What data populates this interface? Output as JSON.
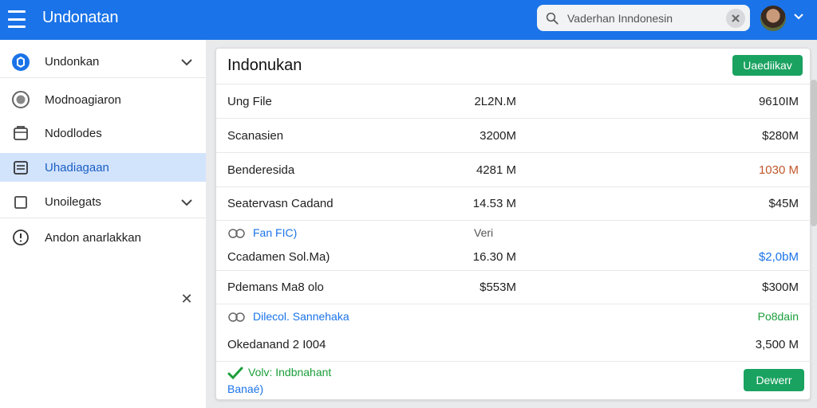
{
  "header": {
    "app_title": "Undonatan",
    "search_text": "Vaderhan Inndonesin",
    "menu_icon": "hamburger-menu-icon",
    "search_icon": "search-icon",
    "clear_icon": "clear-icon",
    "avatar_icon": "user-avatar",
    "avatar_caret_icon": "chevron-down-icon"
  },
  "sidebar": {
    "items": [
      {
        "label": "Undonkan",
        "icon": "app-logo-icon",
        "expandable": true
      },
      {
        "label": "Modnoagiaron",
        "icon": "circle-settings-icon"
      },
      {
        "label": "Ndodlodes",
        "icon": "folder-icon"
      },
      {
        "label": "Uhadiagaan",
        "icon": "document-icon",
        "active": true
      },
      {
        "label": "Unoilegats",
        "icon": "checkbox-icon",
        "expandable": true
      },
      {
        "label": "Andon anarlakkan",
        "icon": "info-icon"
      }
    ],
    "close_icon": "close-icon"
  },
  "main": {
    "title": "Indonukan",
    "top_button": "Uaediikav",
    "bottom_button": "Dewerr",
    "rows": [
      {
        "name": "Ung File",
        "value": "2L2N.M",
        "amount": "9610IM"
      },
      {
        "name": "Scanasien",
        "value": "3200M",
        "amount": "$280M"
      },
      {
        "name": "Benderesida",
        "value": "4281 M",
        "amount": "1030 M",
        "amount_color": "#c0572a"
      },
      {
        "name": "Seatervasn Cadand",
        "value": "14.53 M",
        "amount": "$45M"
      },
      {
        "name": "Fan FIC)",
        "value": "Veri",
        "amount": "",
        "sub": true
      },
      {
        "name": "Ccadamen Sol.Ma)",
        "value": "16.30 M",
        "amount": "$2,0bM",
        "amount_color": "#1a73e8"
      },
      {
        "name": "Pdemans Ma8 olo",
        "value": "$553M",
        "amount": "$300M"
      },
      {
        "name": "Dilecol. Sannehaka",
        "value": "",
        "amount": "Po8dain",
        "amount_color": "#1a9e3a",
        "sub": true
      },
      {
        "name": "Okedanand 2 I004",
        "value": "",
        "amount": "3,500 M"
      }
    ],
    "footer_note": {
      "line1": "Volv: Indbnahant",
      "line2": "Banaé)",
      "icon": "check-icon"
    }
  },
  "colors": {
    "topbar": "#1a73e8",
    "accent_green": "#1aa260",
    "active_nav": "#d2e3fc"
  }
}
